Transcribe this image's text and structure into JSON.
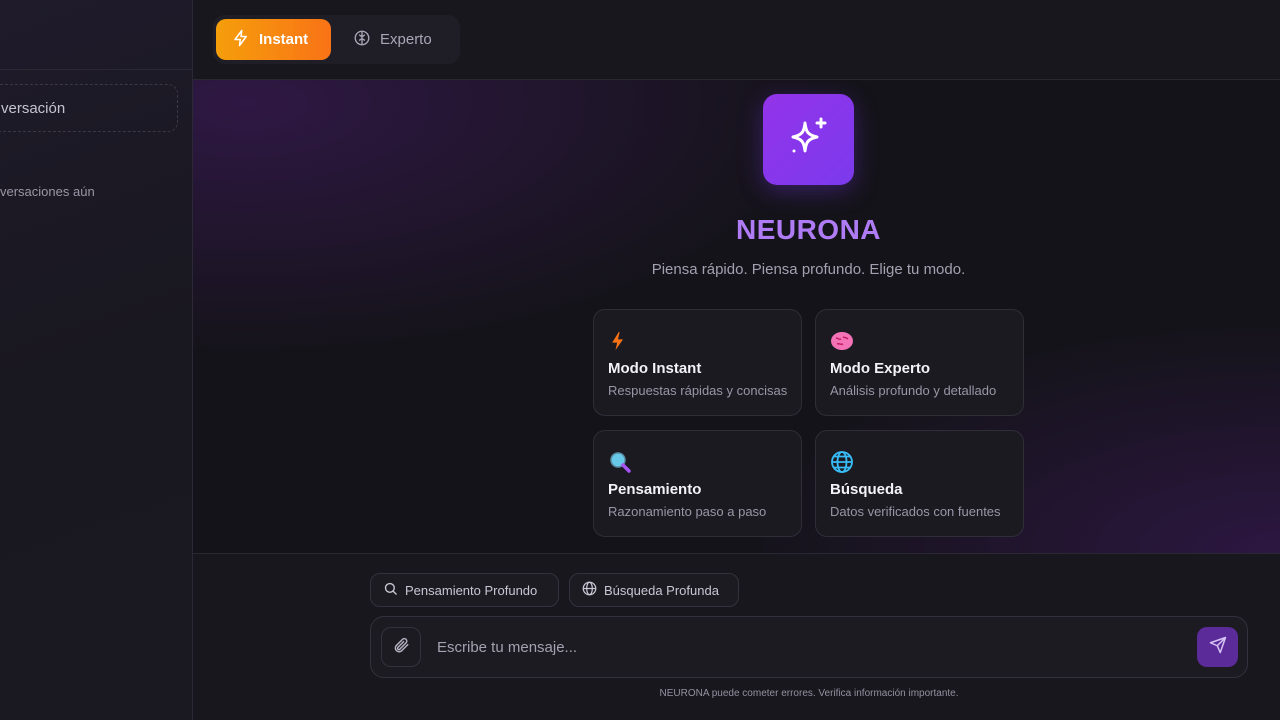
{
  "sidebar": {
    "new_chat_label": "versación",
    "empty_history": "versaciones aún"
  },
  "topbar": {
    "modes": [
      {
        "label": "Instant",
        "icon": "bolt-icon",
        "active": true
      },
      {
        "label": "Experto",
        "icon": "brain-icon",
        "active": false
      }
    ]
  },
  "hero": {
    "logo_icon": "sparkles-icon",
    "brand": "NEURONA",
    "tagline": "Piensa rápido. Piensa profundo. Elige tu modo."
  },
  "cards": [
    {
      "title": "Modo Instant",
      "subtitle": "Respuestas rápidas y concisas",
      "icon": "bolt-emoji-icon"
    },
    {
      "title": "Modo Experto",
      "subtitle": "Análisis profundo y detallado",
      "icon": "brain-emoji-icon"
    },
    {
      "title": "Pensamiento",
      "subtitle": "Razonamiento paso a paso",
      "icon": "magnifier-emoji-icon"
    },
    {
      "title": "Búsqueda",
      "subtitle": "Datos verificados con fuentes",
      "icon": "globe-emoji-icon"
    }
  ],
  "composer": {
    "chips": [
      {
        "label": "Pensamiento Profundo",
        "icon": "search-icon"
      },
      {
        "label": "Búsqueda Profunda",
        "icon": "globe-icon"
      }
    ],
    "placeholder": "Escribe tu mensaje...",
    "value": "",
    "disclaimer": "NEURONA puede cometer errores. Verifica información importante."
  },
  "colors": {
    "accent_orange": "#f97316",
    "accent_purple": "#7c3aed",
    "brand_text": "#b07cf6",
    "background": "#141319"
  }
}
